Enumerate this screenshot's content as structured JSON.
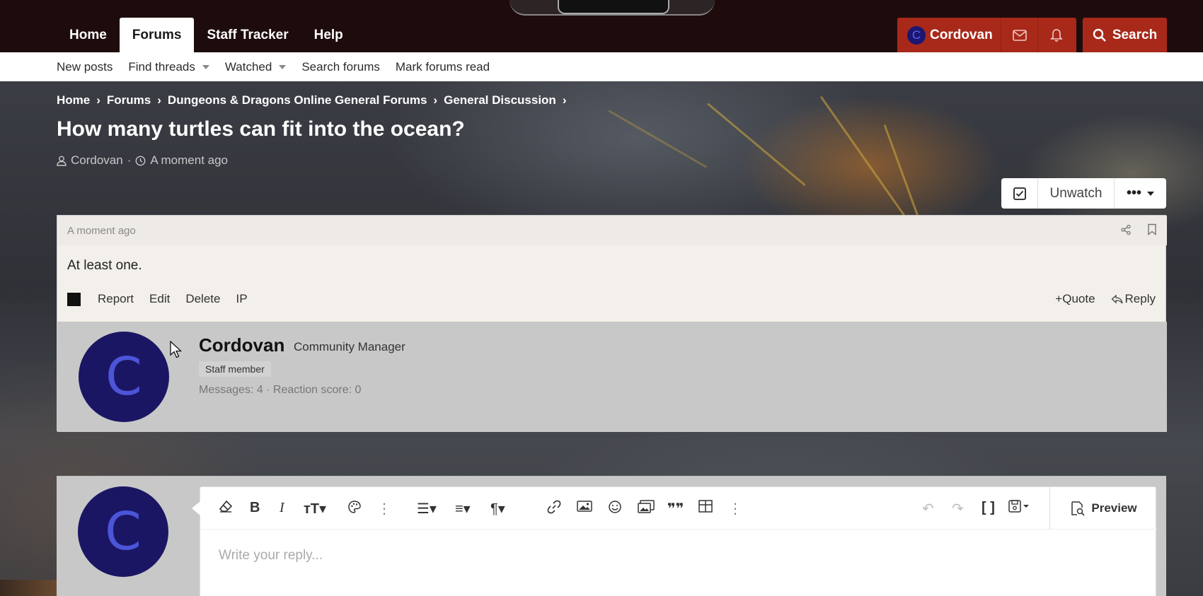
{
  "nav": {
    "tabs": [
      {
        "label": "Home"
      },
      {
        "label": "Forums",
        "active": true
      },
      {
        "label": "Staff Tracker"
      },
      {
        "label": "Help"
      }
    ],
    "user": {
      "initial": "C",
      "name": "Cordovan"
    },
    "search_label": "Search",
    "accent_color": "#a8291a"
  },
  "subnav": {
    "items": [
      {
        "label": "New posts"
      },
      {
        "label": "Find threads"
      },
      {
        "label": "Watched"
      },
      {
        "label": "Search forums"
      },
      {
        "label": "Mark forums read"
      }
    ]
  },
  "breadcrumb": [
    "Home",
    "Forums",
    "Dungeons & Dragons Online General Forums",
    "General Discussion"
  ],
  "thread": {
    "title": "How many turtles can fit into the ocean?",
    "author": "Cordovan",
    "time": "A moment ago",
    "separator": "·"
  },
  "watch": {
    "label": "Unwatch",
    "more": "•••"
  },
  "post": {
    "time": "A moment ago",
    "body": "At least one.",
    "actions": [
      "Report",
      "Edit",
      "Delete",
      "IP"
    ],
    "quote_label": "Quote",
    "reply_label": "Reply",
    "author": {
      "initial": "C",
      "name": "Cordovan",
      "role": "Community Manager",
      "badge": "Staff member",
      "stats": "Messages: 4 · Reaction score: 0"
    }
  },
  "editor": {
    "placeholder": "Write your reply...",
    "preview_label": "Preview",
    "avatar_initial": "C"
  }
}
